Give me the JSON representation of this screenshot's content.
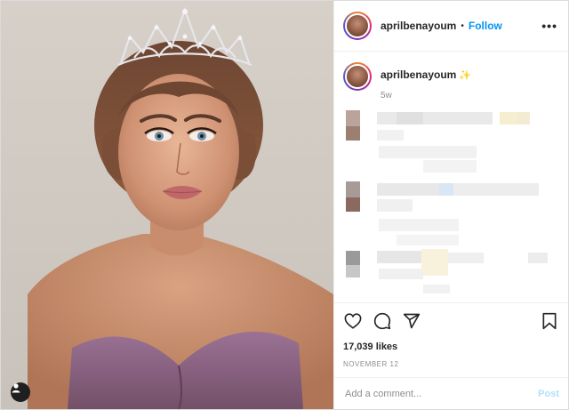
{
  "post": {
    "username": "aprilbenayoum",
    "follow_label": "Follow",
    "separator": "•",
    "more_label": "•••",
    "caption_username": "aprilbenayoum",
    "caption_emoji": "✨",
    "age": "5w",
    "likes": "17,039 likes",
    "date": "NOVEMBER 12",
    "comment_placeholder": "Add a comment...",
    "post_label": "Post"
  },
  "icons": {
    "like": "heart-icon",
    "comment": "comment-icon",
    "share": "paper-plane-icon",
    "save": "bookmark-icon",
    "more": "more-options-icon",
    "user_tag": "user-tag-icon"
  },
  "colors": {
    "accent": "#0095f6",
    "post_disabled": "#b2dffc",
    "muted": "#8e8e8e",
    "dress": "#8a6585"
  }
}
